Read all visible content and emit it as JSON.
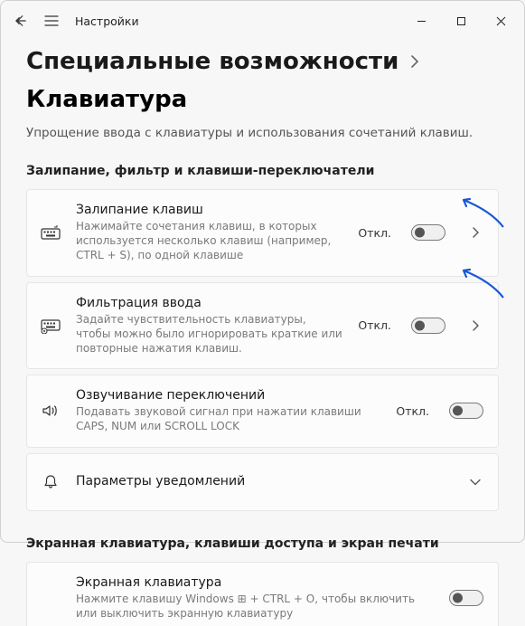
{
  "titlebar": {
    "title": "Настройки"
  },
  "breadcrumb": {
    "parent": "Специальные возможности",
    "current": "Клавиатура"
  },
  "subtitle": "Упрощение ввода с клавиатуры и использования сочетаний клавиш.",
  "sections": {
    "sticky": {
      "label": "Залипание, фильтр и клавиши-переключатели",
      "items": [
        {
          "title": "Залипание клавиш",
          "desc": "Нажимайте сочетания клавиш, в которых используется несколько клавиш (например, CTRL + S), по одной клавише",
          "state": "Откл."
        },
        {
          "title": "Фильтрация ввода",
          "desc": "Задайте чувствительность клавиатуры, чтобы можно было игнорировать краткие или повторные нажатия клавиш.",
          "state": "Откл."
        },
        {
          "title": "Озвучивание переключений",
          "desc": "Подавать звуковой сигнал при нажатии клавиши CAPS, NUM или SCROLL LOCK",
          "state": "Откл."
        },
        {
          "title": "Параметры уведомлений",
          "desc": "",
          "state": ""
        }
      ]
    },
    "osk": {
      "label": "Экранная клавиатура, клавиши доступа и экран печати",
      "items": [
        {
          "title": "Экранная клавиатура",
          "desc": "Нажмите клавишу Windows ⊞ + CTRL + O, чтобы включить или выключить экранную клавиатуру",
          "state": ""
        }
      ]
    }
  }
}
